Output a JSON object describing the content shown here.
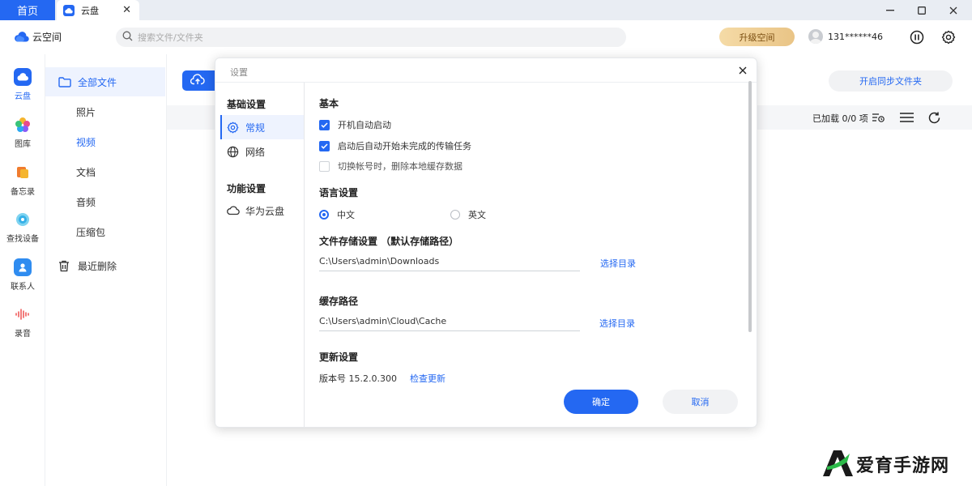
{
  "titlebar": {
    "home_tab": "首页",
    "cloud_tab": "云盘"
  },
  "appbar": {
    "logo_text": "云空间",
    "search_placeholder": "搜索文件/文件夹",
    "upgrade_label": "升级空间",
    "account": "131******46"
  },
  "rail": {
    "items": [
      {
        "label": "云盘",
        "icon": "cloud-drive-icon"
      },
      {
        "label": "图库",
        "icon": "gallery-icon"
      },
      {
        "label": "备忘录",
        "icon": "notes-icon"
      },
      {
        "label": "查找设备",
        "icon": "find-device-icon"
      },
      {
        "label": "联系人",
        "icon": "contacts-icon"
      },
      {
        "label": "录音",
        "icon": "recorder-icon"
      }
    ]
  },
  "subnav": {
    "items": [
      {
        "label": "全部文件",
        "icon": "folder-icon"
      },
      {
        "label": "照片"
      },
      {
        "label": "视频"
      },
      {
        "label": "文档"
      },
      {
        "label": "音频"
      },
      {
        "label": "压缩包"
      },
      {
        "label": "最近删除",
        "icon": "trash-icon"
      }
    ]
  },
  "main": {
    "sync_label": "开启同步文件夹",
    "loaded_text": "已加载 0/0 项"
  },
  "dialog": {
    "title": "设置",
    "side": {
      "group_basic": "基础设置",
      "item_general": "常规",
      "item_network": "网络",
      "group_feature": "功能设置",
      "item_huawei_cloud": "华为云盘"
    },
    "basic": {
      "title": "基本",
      "options": [
        {
          "label": "开机自动启动",
          "checked": true
        },
        {
          "label": "启动后自动开始未完成的传输任务",
          "checked": true
        },
        {
          "label": "切换帐号时，删除本地缓存数据",
          "checked": false
        }
      ]
    },
    "language": {
      "title": "语言设置",
      "chinese": "中文",
      "english": "英文",
      "selected": "中文"
    },
    "storage": {
      "title": "文件存储设置 （默认存储路径）",
      "path": "C:\\Users\\admin\\Downloads",
      "choose_label": "选择目录"
    },
    "cache": {
      "title": "缓存路径",
      "path": "C:\\Users\\admin\\Cloud\\Cache",
      "choose_label": "选择目录"
    },
    "update": {
      "title": "更新设置",
      "version": "版本号 15.2.0.300",
      "check_label": "检查更新"
    },
    "ok_label": "确定",
    "cancel_label": "取消"
  },
  "watermark": {
    "text": "爱育手游网"
  },
  "colors": {
    "accent": "#2468f2",
    "upgrade_gold": "#e9c486"
  }
}
